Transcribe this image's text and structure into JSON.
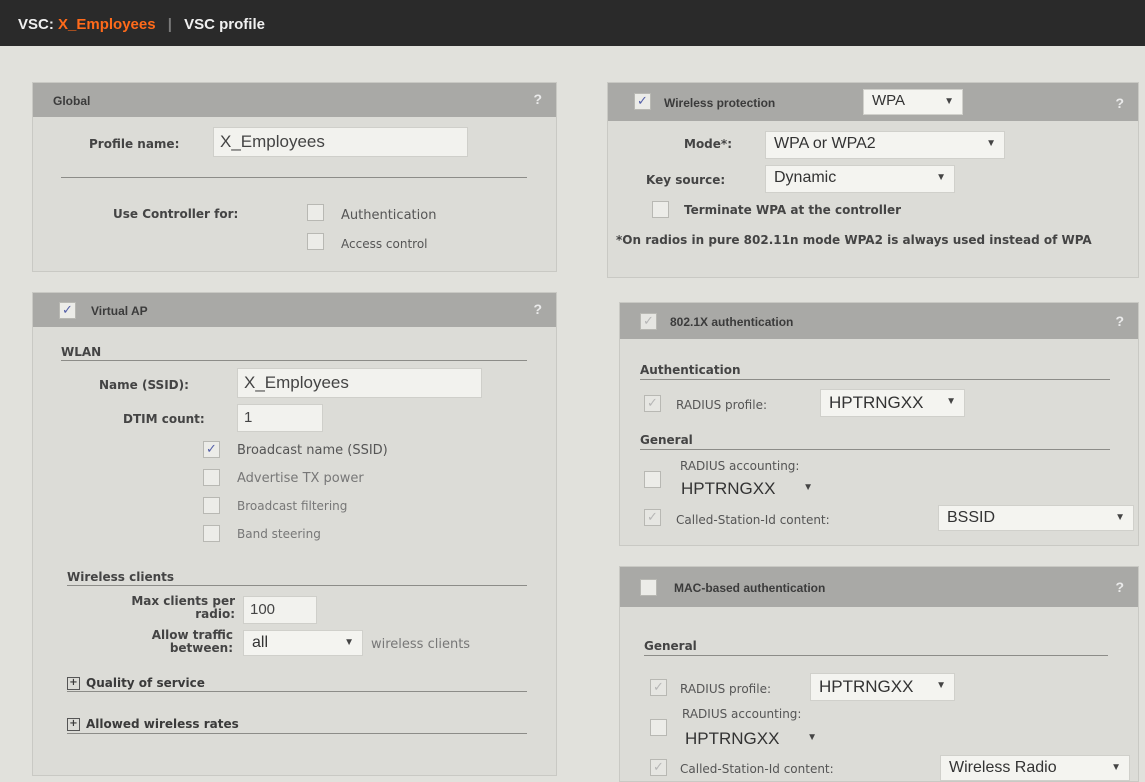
{
  "titlebar": {
    "prefix": "VSC:",
    "vsc_name": "X_Employees",
    "separator": "|",
    "page": "VSC profile"
  },
  "global": {
    "title": "Global",
    "help": "?",
    "profile_name_label": "Profile name:",
    "profile_name_value": "X_Employees",
    "use_controller_label": "Use Controller for:",
    "authentication_label": "Authentication",
    "access_control_label": "Access control"
  },
  "wireless_protection": {
    "title": "Wireless protection",
    "checked": "✓",
    "type_value": "WPA",
    "help": "?",
    "mode_label": "Mode*:",
    "mode_value": "WPA or WPA2",
    "key_source_label": "Key source:",
    "key_source_value": "Dynamic",
    "terminate_label": "Terminate WPA at the controller",
    "note": "*On radios in pure 802.11n mode WPA2 is always used instead of WPA"
  },
  "virtual_ap": {
    "title": "Virtual AP",
    "checked": "✓",
    "help": "?",
    "wlan_section": "WLAN",
    "ssid_label": "Name (SSID):",
    "ssid_value": "X_Employees",
    "dtim_label": "DTIM count:",
    "dtim_value": "1",
    "broadcast_ssid_label": "Broadcast name (SSID)",
    "broadcast_ssid_checked": "✓",
    "advertise_tx_label": "Advertise TX power",
    "broadcast_filtering_label": "Broadcast filtering",
    "band_steering_label": "Band steering",
    "wireless_clients_section": "Wireless clients",
    "max_clients_label_1": "Max clients per",
    "max_clients_label_2": "radio:",
    "max_clients_value": "100",
    "allow_traffic_label_1": "Allow traffic",
    "allow_traffic_label_2": "between:",
    "allow_traffic_value": "all",
    "wireless_clients_suffix": "wireless clients",
    "qos_label": "Quality of service",
    "rates_label": "Allowed wireless rates",
    "expand_symbol": "+"
  },
  "dot1x": {
    "title": "802.1X authentication",
    "checked": "✓",
    "help": "?",
    "auth_section": "Authentication",
    "radius_profile_label": "RADIUS profile:",
    "radius_profile_value": "HPTRNGXX",
    "radius_profile_checked": "✓",
    "general_section": "General",
    "radius_accounting_label": "RADIUS accounting:",
    "radius_accounting_value": "HPTRNGXX",
    "called_station_label": "Called-Station-Id content:",
    "called_station_value": "BSSID",
    "called_station_checked": "✓"
  },
  "mac_auth": {
    "title": "MAC-based authentication",
    "help": "?",
    "general_section": "General",
    "radius_profile_label": "RADIUS profile:",
    "radius_profile_value": "HPTRNGXX",
    "radius_profile_checked": "✓",
    "radius_accounting_label": "RADIUS accounting:",
    "radius_accounting_value": "HPTRNGXX",
    "called_station_label": "Called-Station-Id content:",
    "called_station_value": "Wireless Radio",
    "called_station_checked": "✓"
  },
  "icons": {
    "dropdown": "▼"
  }
}
